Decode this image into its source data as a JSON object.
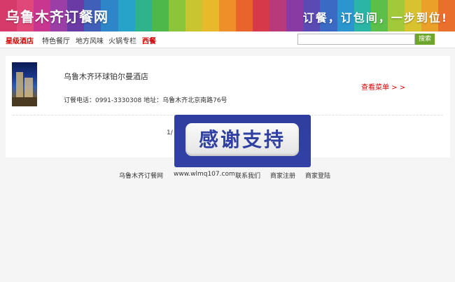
{
  "header": {
    "site_title": "乌鲁木齐订餐网",
    "slogan": "订餐，订包间，一步到位!",
    "stripe_colors": [
      "#d63a6a",
      "#e0487a",
      "#c8368f",
      "#9b3fa7",
      "#6a3aa5",
      "#3f5fb8",
      "#2e86c8",
      "#27a3c9",
      "#2fb38a",
      "#4fb84b",
      "#8cc43a",
      "#c9c530",
      "#e8b92a",
      "#ef8f2a",
      "#e9632c",
      "#d63a4a",
      "#b83a7a",
      "#8a3aa3",
      "#5a4ab3",
      "#3a6ac3",
      "#2a95cf",
      "#2ab5a5",
      "#5bbf4a",
      "#a3c83a",
      "#d9c22f",
      "#eba02a",
      "#e9702c"
    ]
  },
  "nav": {
    "items": [
      {
        "label": "星级酒店",
        "highlight": true
      },
      {
        "label": "特色餐厅",
        "highlight": false
      },
      {
        "label": "地方风味",
        "highlight": false
      },
      {
        "label": "火锅专栏",
        "highlight": false
      },
      {
        "label": "西餐",
        "highlight": true
      }
    ],
    "search_placeholder": "",
    "search_label": "搜索"
  },
  "listing": {
    "hotel_name": "乌鲁木齐环球铂尔曼酒店",
    "contact": "订餐电话：0991-3330308   地址：乌鲁木齐北京南路76号",
    "menu_link": "查看菜单 > >",
    "pager": "1/"
  },
  "overlay": {
    "text": "感谢支持"
  },
  "footer": {
    "site_name": "乌鲁木齐订餐网",
    "url": "www.wlmq107.com",
    "links": [
      "联系我们",
      "商家注册",
      "商家登陆"
    ]
  },
  "colors": {
    "accent_red": "#d40000",
    "search_green": "#6ea52c",
    "overlay_blue": "#2f3e9e"
  }
}
